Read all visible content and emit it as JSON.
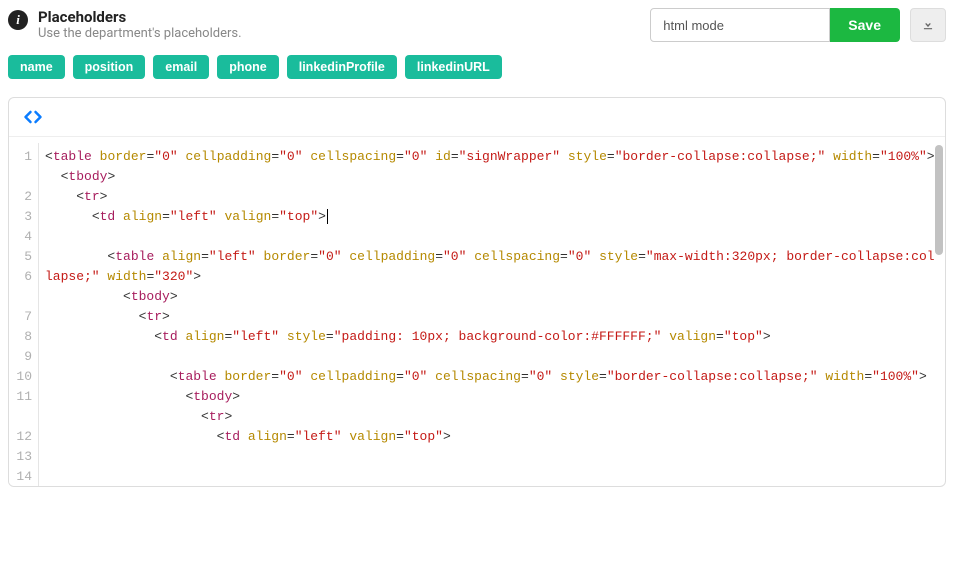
{
  "header": {
    "title": "Placeholders",
    "subtitle": "Use the department's placeholders.",
    "mode_value": "html mode",
    "save_label": "Save"
  },
  "placeholder_tags": [
    "name",
    "position",
    "email",
    "phone",
    "linkedinProfile",
    "linkedinURL"
  ],
  "code_lines": [
    {
      "n": 1,
      "wraps": true,
      "tokens": [
        {
          "t": "punc",
          "v": "<"
        },
        {
          "t": "tag",
          "v": "table"
        },
        {
          "t": "plain",
          "v": " "
        },
        {
          "t": "attr",
          "v": "border"
        },
        {
          "t": "eq",
          "v": "="
        },
        {
          "t": "str",
          "v": "\"0\""
        },
        {
          "t": "plain",
          "v": " "
        },
        {
          "t": "attr",
          "v": "cellpadding"
        },
        {
          "t": "eq",
          "v": "="
        },
        {
          "t": "str",
          "v": "\"0\""
        },
        {
          "t": "plain",
          "v": " "
        },
        {
          "t": "attr",
          "v": "cellspacing"
        },
        {
          "t": "eq",
          "v": "="
        },
        {
          "t": "str",
          "v": "\"0\""
        },
        {
          "t": "plain",
          "v": " "
        },
        {
          "t": "attr",
          "v": "id"
        },
        {
          "t": "eq",
          "v": "="
        },
        {
          "t": "str",
          "v": "\"signWrapper\""
        },
        {
          "t": "plain",
          "v": " "
        },
        {
          "t": "attr",
          "v": "style"
        },
        {
          "t": "eq",
          "v": "="
        },
        {
          "t": "str",
          "v": "\"border-collapse:collapse;\""
        },
        {
          "t": "plain",
          "v": " "
        },
        {
          "t": "attr",
          "v": "width"
        },
        {
          "t": "eq",
          "v": "="
        },
        {
          "t": "str",
          "v": "\"100%\""
        },
        {
          "t": "punc",
          "v": ">"
        }
      ]
    },
    {
      "n": 2,
      "tokens": [
        {
          "t": "plain",
          "v": "  "
        },
        {
          "t": "punc",
          "v": "<"
        },
        {
          "t": "tag",
          "v": "tbody"
        },
        {
          "t": "punc",
          "v": ">"
        }
      ]
    },
    {
      "n": 3,
      "tokens": [
        {
          "t": "plain",
          "v": "    "
        },
        {
          "t": "punc",
          "v": "<"
        },
        {
          "t": "tag",
          "v": "tr"
        },
        {
          "t": "punc",
          "v": ">"
        }
      ]
    },
    {
      "n": 4,
      "cursor": true,
      "tokens": [
        {
          "t": "plain",
          "v": "      "
        },
        {
          "t": "punc",
          "v": "<"
        },
        {
          "t": "tag",
          "v": "td"
        },
        {
          "t": "plain",
          "v": " "
        },
        {
          "t": "attr",
          "v": "align"
        },
        {
          "t": "eq",
          "v": "="
        },
        {
          "t": "str",
          "v": "\"left\""
        },
        {
          "t": "plain",
          "v": " "
        },
        {
          "t": "attr",
          "v": "valign"
        },
        {
          "t": "eq",
          "v": "="
        },
        {
          "t": "str",
          "v": "\"top\""
        },
        {
          "t": "punc",
          "v": ">"
        }
      ]
    },
    {
      "n": 5,
      "tokens": []
    },
    {
      "n": 6,
      "wraps": true,
      "tokens": [
        {
          "t": "plain",
          "v": "        "
        },
        {
          "t": "punc",
          "v": "<"
        },
        {
          "t": "tag",
          "v": "table"
        },
        {
          "t": "plain",
          "v": " "
        },
        {
          "t": "attr",
          "v": "align"
        },
        {
          "t": "eq",
          "v": "="
        },
        {
          "t": "str",
          "v": "\"left\""
        },
        {
          "t": "plain",
          "v": " "
        },
        {
          "t": "attr",
          "v": "border"
        },
        {
          "t": "eq",
          "v": "="
        },
        {
          "t": "str",
          "v": "\"0\""
        },
        {
          "t": "plain",
          "v": " "
        },
        {
          "t": "attr",
          "v": "cellpadding"
        },
        {
          "t": "eq",
          "v": "="
        },
        {
          "t": "str",
          "v": "\"0\""
        },
        {
          "t": "plain",
          "v": " "
        },
        {
          "t": "attr",
          "v": "cellspacing"
        },
        {
          "t": "eq",
          "v": "="
        },
        {
          "t": "str",
          "v": "\"0\""
        },
        {
          "t": "plain",
          "v": " "
        },
        {
          "t": "attr",
          "v": "style"
        },
        {
          "t": "eq",
          "v": "="
        },
        {
          "t": "str",
          "v": "\"max-width:320px; border-collapse:collapse;\""
        },
        {
          "t": "plain",
          "v": " "
        },
        {
          "t": "attr",
          "v": "width"
        },
        {
          "t": "eq",
          "v": "="
        },
        {
          "t": "str",
          "v": "\"320\""
        },
        {
          "t": "punc",
          "v": ">"
        }
      ]
    },
    {
      "n": 7,
      "tokens": [
        {
          "t": "plain",
          "v": "          "
        },
        {
          "t": "punc",
          "v": "<"
        },
        {
          "t": "tag",
          "v": "tbody"
        },
        {
          "t": "punc",
          "v": ">"
        }
      ]
    },
    {
      "n": 8,
      "tokens": [
        {
          "t": "plain",
          "v": "            "
        },
        {
          "t": "punc",
          "v": "<"
        },
        {
          "t": "tag",
          "v": "tr"
        },
        {
          "t": "punc",
          "v": ">"
        }
      ]
    },
    {
      "n": 9,
      "tokens": [
        {
          "t": "plain",
          "v": "              "
        },
        {
          "t": "punc",
          "v": "<"
        },
        {
          "t": "tag",
          "v": "td"
        },
        {
          "t": "plain",
          "v": " "
        },
        {
          "t": "attr",
          "v": "align"
        },
        {
          "t": "eq",
          "v": "="
        },
        {
          "t": "str",
          "v": "\"left\""
        },
        {
          "t": "plain",
          "v": " "
        },
        {
          "t": "attr",
          "v": "style"
        },
        {
          "t": "eq",
          "v": "="
        },
        {
          "t": "str",
          "v": "\"padding: 10px; background-color:#FFFFFF;\""
        },
        {
          "t": "plain",
          "v": " "
        },
        {
          "t": "attr",
          "v": "valign"
        },
        {
          "t": "eq",
          "v": "="
        },
        {
          "t": "str",
          "v": "\"top\""
        },
        {
          "t": "punc",
          "v": ">"
        }
      ]
    },
    {
      "n": 10,
      "tokens": []
    },
    {
      "n": 11,
      "wraps": true,
      "tokens": [
        {
          "t": "plain",
          "v": "                "
        },
        {
          "t": "punc",
          "v": "<"
        },
        {
          "t": "tag",
          "v": "table"
        },
        {
          "t": "plain",
          "v": " "
        },
        {
          "t": "attr",
          "v": "border"
        },
        {
          "t": "eq",
          "v": "="
        },
        {
          "t": "str",
          "v": "\"0\""
        },
        {
          "t": "plain",
          "v": " "
        },
        {
          "t": "attr",
          "v": "cellpadding"
        },
        {
          "t": "eq",
          "v": "="
        },
        {
          "t": "str",
          "v": "\"0\""
        },
        {
          "t": "plain",
          "v": " "
        },
        {
          "t": "attr",
          "v": "cellspacing"
        },
        {
          "t": "eq",
          "v": "="
        },
        {
          "t": "str",
          "v": "\"0\""
        },
        {
          "t": "plain",
          "v": " "
        },
        {
          "t": "attr",
          "v": "style"
        },
        {
          "t": "eq",
          "v": "="
        },
        {
          "t": "str",
          "v": "\"border-collapse:collapse;\""
        },
        {
          "t": "plain",
          "v": " "
        },
        {
          "t": "attr",
          "v": "width"
        },
        {
          "t": "eq",
          "v": "="
        },
        {
          "t": "str",
          "v": "\"100%\""
        },
        {
          "t": "punc",
          "v": ">"
        }
      ]
    },
    {
      "n": 12,
      "tokens": [
        {
          "t": "plain",
          "v": "                  "
        },
        {
          "t": "punc",
          "v": "<"
        },
        {
          "t": "tag",
          "v": "tbody"
        },
        {
          "t": "punc",
          "v": ">"
        }
      ]
    },
    {
      "n": 13,
      "tokens": [
        {
          "t": "plain",
          "v": "                    "
        },
        {
          "t": "punc",
          "v": "<"
        },
        {
          "t": "tag",
          "v": "tr"
        },
        {
          "t": "punc",
          "v": ">"
        }
      ]
    },
    {
      "n": 14,
      "tokens": [
        {
          "t": "plain",
          "v": "                      "
        },
        {
          "t": "punc",
          "v": "<"
        },
        {
          "t": "tag",
          "v": "td"
        },
        {
          "t": "plain",
          "v": " "
        },
        {
          "t": "attr",
          "v": "align"
        },
        {
          "t": "eq",
          "v": "="
        },
        {
          "t": "str",
          "v": "\"left\""
        },
        {
          "t": "plain",
          "v": " "
        },
        {
          "t": "attr",
          "v": "valign"
        },
        {
          "t": "eq",
          "v": "="
        },
        {
          "t": "str",
          "v": "\"top\""
        },
        {
          "t": "punc",
          "v": ">"
        }
      ]
    }
  ]
}
